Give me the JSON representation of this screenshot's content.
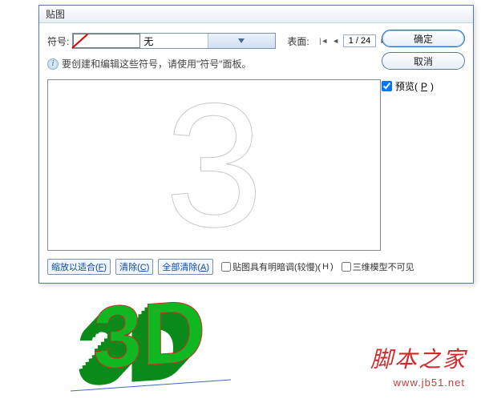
{
  "dialog": {
    "title": "贴图",
    "symbol_label": "符号:",
    "symbol_value": "无",
    "face_label": "表面:",
    "page": "1 / 24",
    "hint": "要创建和编辑这些符号，请使用\"符号\"面板。",
    "preview_glyph": "3"
  },
  "buttons": {
    "ok": "确定",
    "cancel": "取消"
  },
  "preview": {
    "label": "预览(",
    "accel": "P",
    "suffix": ")",
    "checked": true
  },
  "bottom": {
    "fit": {
      "pre": "缩放以适合(",
      "accel": "F",
      "suf": ")"
    },
    "clear": {
      "pre": "清除(",
      "accel": "C",
      "suf": ")"
    },
    "clear_all": {
      "pre": "全部清除(",
      "accel": "A",
      "suf": ")"
    },
    "shade": {
      "pre": "贴图具有明暗调(较慢)(",
      "accel": "H",
      "suf": ")"
    },
    "invisible": "三维模型不可见"
  },
  "artwork": {
    "text_3d": "3D"
  },
  "watermark": {
    "logo": "脚本之家",
    "url": "www.jb51.net"
  }
}
